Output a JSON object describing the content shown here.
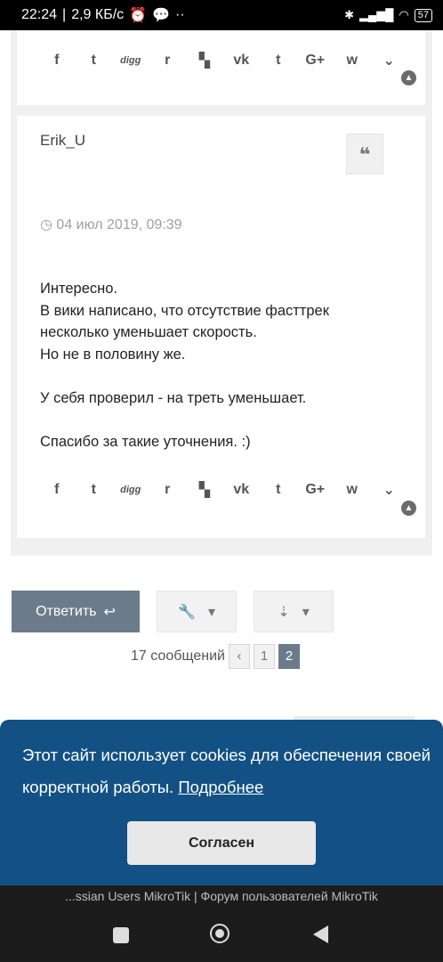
{
  "status_bar": {
    "time": "22:24",
    "speed": "2,9 КБ/с",
    "battery": "57"
  },
  "share_icons": [
    "facebook-icon",
    "twitter-icon",
    "digg-icon",
    "reddit-icon",
    "delicious-icon",
    "vk-icon",
    "tumblr-icon",
    "google-plus-icon",
    "whatsapp-icon",
    "pocket-icon"
  ],
  "share_glyphs": [
    "f",
    "t",
    "digg",
    "r",
    "▚",
    "vk",
    "t",
    "G+",
    "w",
    "⌄"
  ],
  "post": {
    "author": "Erik_U",
    "quote_glyph": "❝",
    "date": "04 июл 2019, 09:39",
    "body_lines": [
      "Интересно.",
      "В вики написано, что отсутствие фасттрек",
      "несколько уменьшает скорость.",
      "Но не в половину же.",
      "",
      "У себя проверил - на треть уменьшает.",
      "",
      "Спасибо за такие уточнения. :)"
    ]
  },
  "actions": {
    "reply_label": "Ответить",
    "reply_glyph": "↩"
  },
  "pagination": {
    "summary": "17 сообщений",
    "prev_glyph": "‹",
    "pages": [
      "1",
      "2"
    ],
    "current": "2"
  },
  "cookie_banner": {
    "text": "Этот сайт использует cookies для обеспечения своей корректной работы.",
    "link": "Подробнее",
    "accept": "Согласен"
  },
  "footer": {
    "title": "...ssian Users MikroTik | Форум пользователей MikroTik"
  },
  "colors": {
    "accent": "#6c7b89",
    "cookie_bg": "#135184"
  }
}
